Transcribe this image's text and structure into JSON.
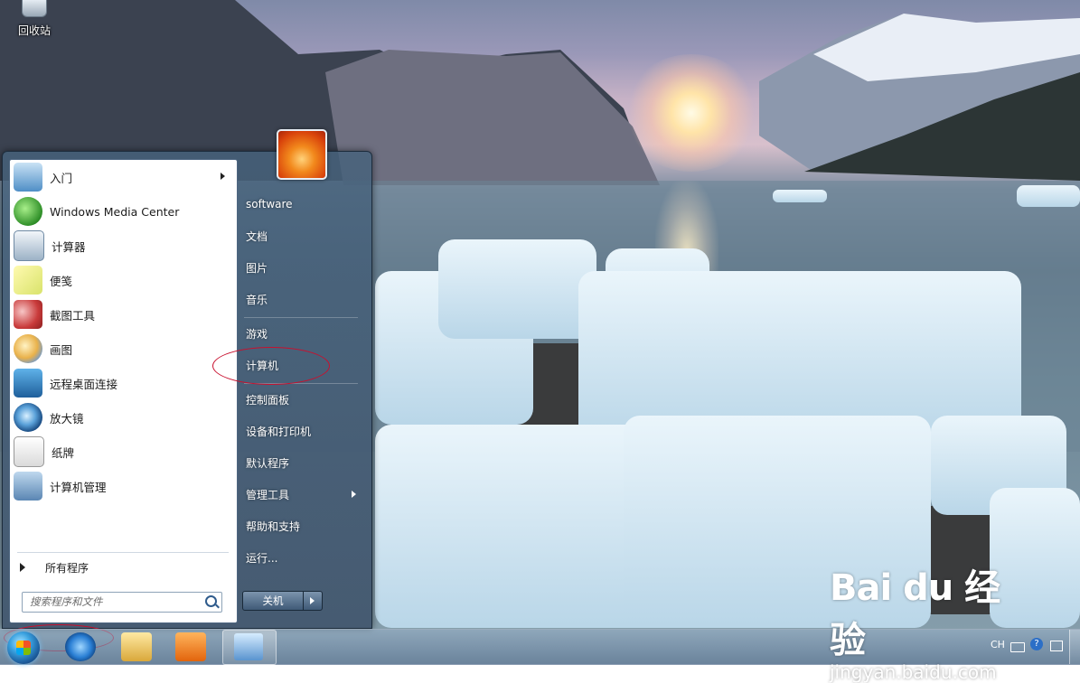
{
  "desktop": {
    "recycle_bin_label": "回收站"
  },
  "start_menu": {
    "programs": [
      {
        "label": "入门",
        "icon": "get-started-icon",
        "has_submenu": true
      },
      {
        "label": "Windows Media Center",
        "icon": "media-center-icon"
      },
      {
        "label": "计算器",
        "icon": "calculator-icon"
      },
      {
        "label": "便笺",
        "icon": "sticky-notes-icon"
      },
      {
        "label": "截图工具",
        "icon": "snipping-tool-icon"
      },
      {
        "label": "画图",
        "icon": "paint-icon"
      },
      {
        "label": "远程桌面连接",
        "icon": "remote-desktop-icon"
      },
      {
        "label": "放大镜",
        "icon": "magnifier-icon"
      },
      {
        "label": "纸牌",
        "icon": "solitaire-icon"
      },
      {
        "label": "计算机管理",
        "icon": "computer-management-icon"
      }
    ],
    "all_programs": "所有程序",
    "search_placeholder": "搜索程序和文件",
    "right_items": [
      {
        "label": "software"
      },
      {
        "label": "文档"
      },
      {
        "label": "图片"
      },
      {
        "label": "音乐"
      },
      {
        "label": "游戏"
      },
      {
        "label": "计算机"
      },
      {
        "label": "控制面板"
      },
      {
        "label": "设备和打印机"
      },
      {
        "label": "默认程序"
      },
      {
        "label": "管理工具",
        "has_submenu": true
      },
      {
        "label": "帮助和支持"
      },
      {
        "label": "运行..."
      }
    ],
    "shutdown_label": "关机"
  },
  "taskbar": {
    "pinned": [
      "internet-explorer-icon",
      "windows-explorer-icon",
      "media-player-icon",
      "control-panel-icon"
    ],
    "tray_language": "CH",
    "tray_help": "?"
  },
  "watermark": {
    "logo": "Bai du 经验",
    "url": "jingyan.baidu.com"
  }
}
